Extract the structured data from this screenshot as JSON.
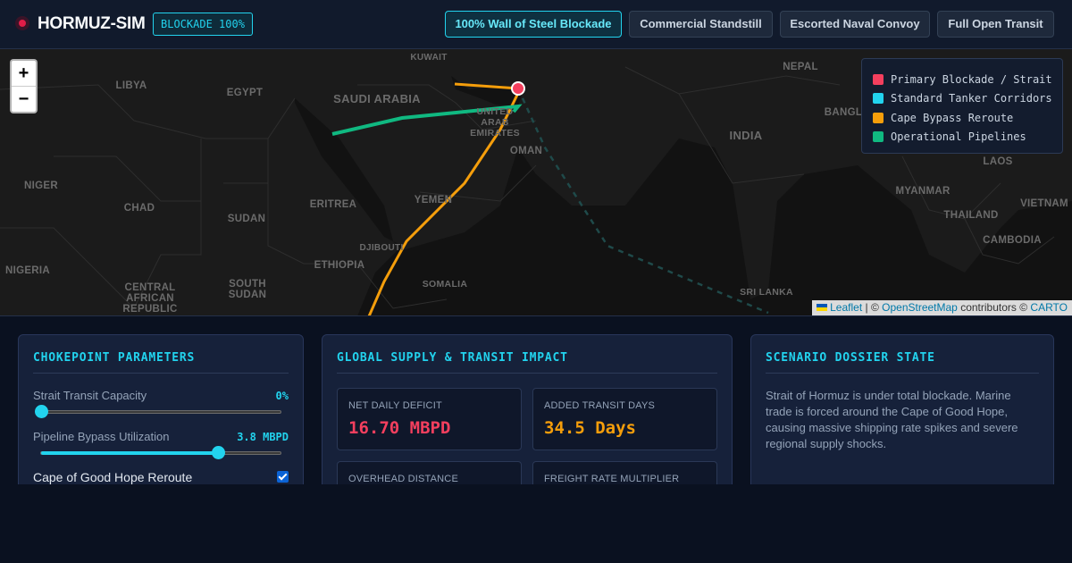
{
  "header": {
    "title": "HORMUZ-SIM",
    "status_badge": "BLOCKADE 100%",
    "scenarios": [
      {
        "label": "100% Wall of Steel Blockade",
        "active": true
      },
      {
        "label": "Commercial Standstill",
        "active": false
      },
      {
        "label": "Escorted Naval Convoy",
        "active": false
      },
      {
        "label": "Full Open Transit",
        "active": false
      }
    ]
  },
  "map": {
    "zoom_in": "+",
    "zoom_out": "−",
    "labels": [
      "LIBYA",
      "EGYPT",
      "KUWAIT",
      "SAUDI ARABIA",
      "UNITED ARAB EMIRATES",
      "OMAN",
      "NEPAL",
      "INDIA",
      "BANGL",
      "LAOS",
      "NIGER",
      "CHAD",
      "SUDAN",
      "ERITREA",
      "YEMEN",
      "DJIBOUTI",
      "ETHIOPIA",
      "SOMALIA",
      "NIGERIA",
      "CENTRAL AFRICAN REPUBLIC",
      "SOUTH SUDAN",
      "MYANMAR",
      "THAILAND",
      "VIETNAM",
      "CAMBODIA",
      "SRI LANKA"
    ],
    "legend": [
      {
        "label": "Primary Blockade / Strait",
        "color": "#f43f5e"
      },
      {
        "label": "Standard Tanker Corridors",
        "color": "#22d3ee"
      },
      {
        "label": "Cape Bypass Reroute",
        "color": "#f59e0b"
      },
      {
        "label": "Operational Pipelines",
        "color": "#10b981"
      }
    ],
    "attribution": {
      "leaflet": "Leaflet",
      "sep1": "| ©",
      "osm": "OpenStreetMap",
      "contrib": "contributors ©",
      "carto": "CARTO"
    }
  },
  "parameters": {
    "title": "CHOKEPOINT PARAMETERS",
    "strait_capacity": {
      "label": "Strait Transit Capacity",
      "value": "0%",
      "fraction": 0.0
    },
    "pipeline_bypass": {
      "label": "Pipeline Bypass Utilization",
      "value": "3.8 MBPD",
      "fraction": 0.74
    },
    "cape_reroute": {
      "label": "Cape of Good Hope Reroute",
      "checked": true
    }
  },
  "impact": {
    "title": "GLOBAL SUPPLY & TRANSIT IMPACT",
    "metrics": [
      {
        "label": "NET DAILY DEFICIT",
        "value": "16.70 MBPD",
        "color": "#f43f5e"
      },
      {
        "label": "ADDED TRANSIT DAYS",
        "value": "34.5 Days",
        "color": "#f59e0b"
      },
      {
        "label": "OVERHEAD DISTANCE",
        "value": "",
        "color": "#22d3ee"
      },
      {
        "label": "FREIGHT RATE MULTIPLIER",
        "value": "",
        "color": "#22d3ee"
      }
    ]
  },
  "dossier": {
    "title": "SCENARIO DOSSIER STATE",
    "text": "Strait of Hormuz is under total blockade. Marine trade is forced around the Cape of Good Hope, causing massive shipping rate spikes and severe regional supply shocks."
  }
}
